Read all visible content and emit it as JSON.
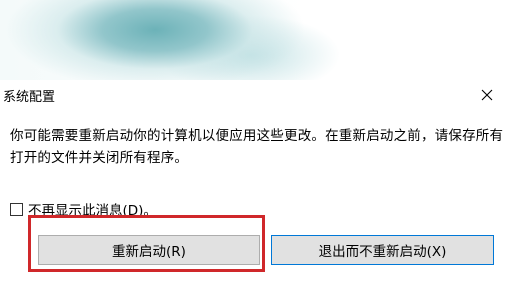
{
  "dialog": {
    "title": "系统配置",
    "close_icon": "close-icon",
    "message": "你可能需要重新启动你的计算机以便应用这些更改。在重新启动之前，请保存所有打开的文件并关闭所有程序。",
    "checkbox": {
      "label": "不再显示此消息(D)。",
      "checked": false
    },
    "buttons": {
      "restart_label": "重新启动(R)",
      "exit_label": "退出而不重新启动(X)"
    }
  },
  "colors": {
    "highlight": "#d0282a",
    "button_face": "#e1e1e1",
    "focus_border": "#0078d7"
  }
}
